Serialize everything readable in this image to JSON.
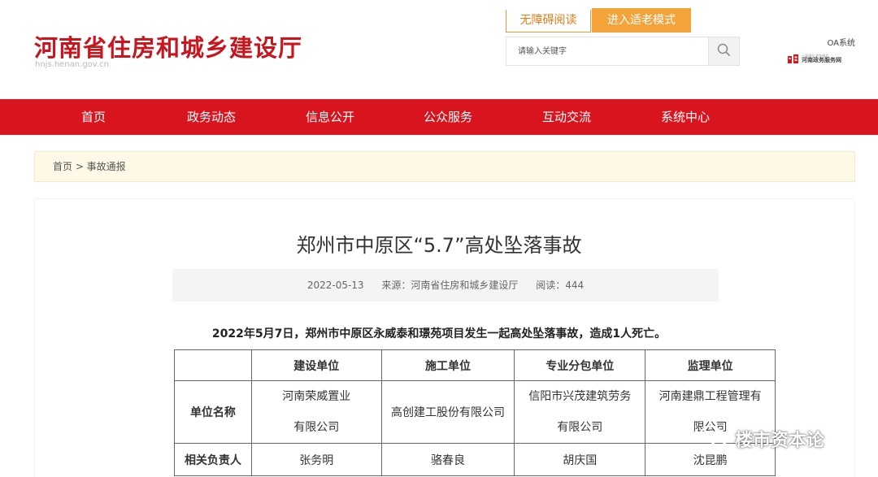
{
  "header": {
    "site_title": "河南省住房和城乡建设厅",
    "site_domain": "hnjs.henan.gov.cn",
    "accessibility_btn": "无障碍阅读",
    "elder_mode_btn": "进入适老模式",
    "search_placeholder": "请输入关键字",
    "oa_link": "OA系统",
    "gov_service_small": "一网通办 政务服务",
    "gov_service_label": "河南政务服务网"
  },
  "nav": {
    "items": [
      {
        "label": "首页"
      },
      {
        "label": "政务动态"
      },
      {
        "label": "信息公开"
      },
      {
        "label": "公众服务"
      },
      {
        "label": "互动交流"
      },
      {
        "label": "系统中心"
      }
    ]
  },
  "breadcrumb": {
    "text": "首页 > 事故通报"
  },
  "article": {
    "title": "郑州市中原区“5.7”高处坠落事故",
    "date": "2022-05-13",
    "source": "来源：河南省住房和城乡建设厅",
    "views": "阅读：444",
    "lead": "2022年5月7日，郑州市中原区永威泰和璟苑项目发生一起高处坠落事故，造成1人死亡。"
  },
  "table": {
    "headers": [
      "",
      "建设单位",
      "施工单位",
      "专业分包单位",
      "监理单位"
    ],
    "row_name": {
      "label": "单位名称",
      "cells": [
        [
          "河南荣威置业",
          "有限公司"
        ],
        [
          "高创建工股份有限公司"
        ],
        [
          "信阳市兴茂建筑劳务",
          "有限公司"
        ],
        [
          "河南建鼎工程管理有",
          "限公司"
        ]
      ]
    },
    "row_person": {
      "label": "相关负责人",
      "cells": [
        "张务明",
        "骆春良",
        "胡庆国",
        "沈昆鹏"
      ]
    }
  },
  "watermark": {
    "text": "楼市资本论"
  },
  "colors": {
    "brand_red": "#d8141e",
    "title_red": "#c9151e",
    "elder_orange": "#f3a33a",
    "breadcrumb_bg": "#fdf9e6"
  }
}
